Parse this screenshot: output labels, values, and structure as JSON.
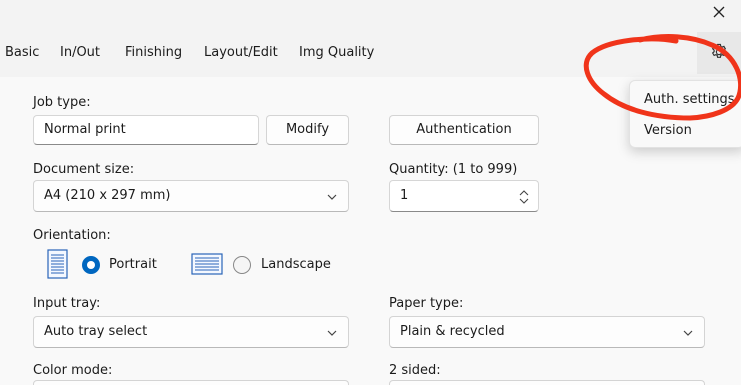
{
  "window": {
    "close_icon": "close-icon"
  },
  "tabs": [
    {
      "label": "Basic"
    },
    {
      "label": "In/Out"
    },
    {
      "label": "Finishing"
    },
    {
      "label": "Layout/Edit"
    },
    {
      "label": "Img Quality"
    }
  ],
  "settings_menu": {
    "icon": "gear-icon",
    "items": [
      {
        "label": "Auth. settings"
      },
      {
        "label": "Version"
      }
    ]
  },
  "form": {
    "job_type": {
      "label": "Job type:",
      "value": "Normal print",
      "modify_label": "Modify"
    },
    "authentication_label": "Authentication",
    "document_size": {
      "label": "Document size:",
      "value": "A4 (210 x 297 mm)"
    },
    "quantity": {
      "label": "Quantity: (1 to 999)",
      "value": "1"
    },
    "orientation": {
      "label": "Orientation:",
      "options": [
        {
          "label": "Portrait",
          "selected": true
        },
        {
          "label": "Landscape",
          "selected": false
        }
      ]
    },
    "input_tray": {
      "label": "Input tray:",
      "value": "Auto tray select"
    },
    "paper_type": {
      "label": "Paper type:",
      "value": "Plain & recycled"
    },
    "color_mode": {
      "label": "Color mode:"
    },
    "two_sided": {
      "label": "2 sided:"
    }
  },
  "annotation": {
    "color": "#f0341a"
  },
  "colors": {
    "accent": "#0067c0"
  }
}
